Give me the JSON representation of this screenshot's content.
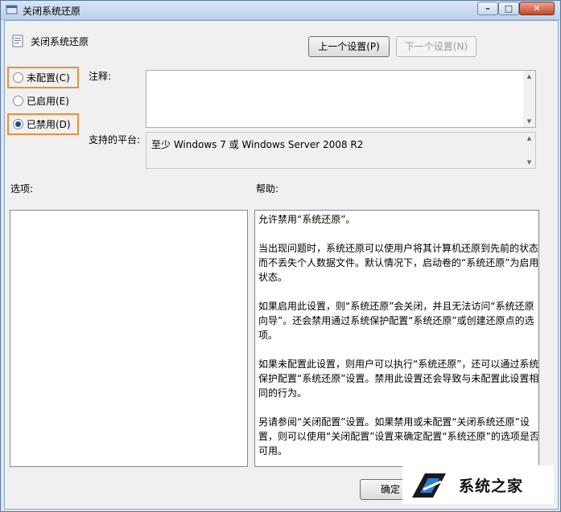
{
  "window": {
    "title": "关闭系统还原"
  },
  "header": {
    "title": "关闭系统还原",
    "prev_label": "上一个设置(P)",
    "next_label": "下一个设置(N)"
  },
  "options": [
    {
      "label": "未配置(C)",
      "selected": false
    },
    {
      "label": "已启用(E)",
      "selected": false
    },
    {
      "label": "已禁用(D)",
      "selected": true
    }
  ],
  "comment": {
    "label": "注释:",
    "value": ""
  },
  "platform": {
    "label": "支持的平台:",
    "value": "至少 Windows 7 或 Windows Server 2008 R2"
  },
  "options_panel": {
    "label": "选项:"
  },
  "help": {
    "label": "帮助:",
    "paragraphs": [
      "允许禁用“系统还原”。",
      "当出现问题时，系统还原可以使用户将其计算机还原到先前的状态而不丢失个人数据文件。默认情况下，启动卷的“系统还原”为启用状态。",
      "如果启用此设置，则“系统还原”会关闭，并且无法访问“系统还原向导”。还会禁用通过系统保护配置“系统还原”或创建还原点的选项。",
      "如果未配置此设置，则用户可以执行“系统还原”，还可以通过系统保护配置“系统还原”设置。禁用此设置还会导致与未配置此设置相同的行为。",
      "另请参阅“关闭配置”设置。如果禁用或未配置“关闭系统还原”设置，则可以使用“关闭配置”设置来确定配置“系统还原”的选项是否可用。"
    ]
  },
  "footer": {
    "ok_label": "确定"
  },
  "watermark": {
    "text": "系统之家"
  },
  "colors": {
    "highlight": "#e6913e",
    "radio_selected": "#1d4b8b"
  }
}
